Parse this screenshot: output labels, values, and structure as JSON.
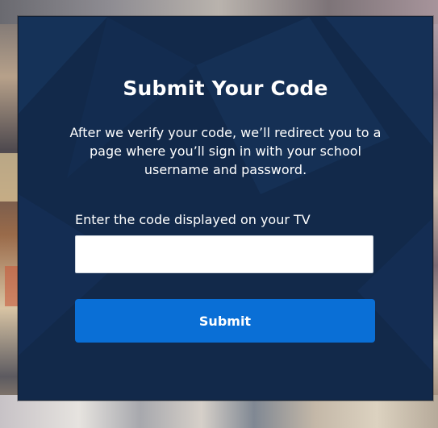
{
  "modal": {
    "title": "Submit Your Code",
    "description": "After we verify your code, we’ll redirect you to a page where you’ll sign in with your school username and password.",
    "code_label": "Enter the code displayed on your TV",
    "code_value": "",
    "code_placeholder": "",
    "submit_label": "Submit"
  },
  "colors": {
    "modal_bg": "#12294a",
    "button_bg": "#0a6fd6",
    "text": "#ffffff"
  }
}
